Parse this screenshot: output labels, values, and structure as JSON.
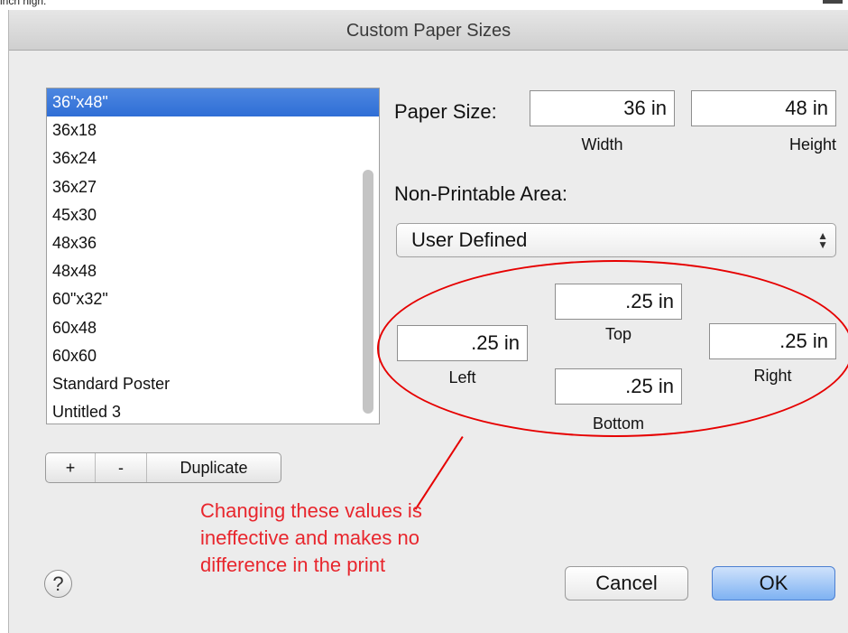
{
  "cropped_caption": "inch high.",
  "window": {
    "title": "Custom Paper Sizes"
  },
  "paper_list": {
    "items": [
      "36\"x48\"",
      "36x18",
      "36x24",
      "36x27",
      "45x30",
      "48x36",
      "48x48",
      "60\"x32\"",
      "60x48",
      "60x60",
      "Standard Poster",
      "Untitled 3"
    ],
    "selected_index": 0
  },
  "list_buttons": {
    "add": "+",
    "remove": "-",
    "duplicate": "Duplicate"
  },
  "paper_size": {
    "label": "Paper Size:",
    "width_value": "36 in",
    "width_label": "Width",
    "height_value": "48 in",
    "height_label": "Height"
  },
  "non_printable": {
    "label": "Non-Printable Area:",
    "selected": "User Defined",
    "top_value": ".25 in",
    "top_label": "Top",
    "left_value": ".25 in",
    "left_label": "Left",
    "right_value": ".25 in",
    "right_label": "Right",
    "bottom_value": ".25 in",
    "bottom_label": "Bottom"
  },
  "annotation": {
    "text": "Changing these values is\nineffective and makes no\ndifference in the print",
    "color": "#e60000"
  },
  "help_button": "?",
  "buttons": {
    "cancel": "Cancel",
    "ok": "OK"
  },
  "colors": {
    "selection": "#3a78dc",
    "ok_button": "#8fbcf4",
    "dialog_bg": "#ececec"
  }
}
